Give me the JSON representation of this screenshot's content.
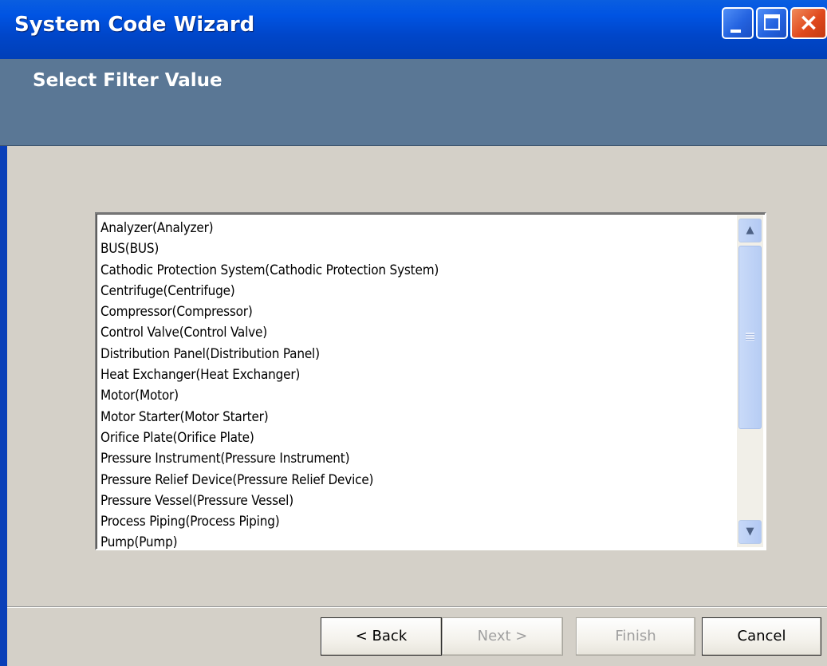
{
  "window": {
    "title": "System Code Wizard",
    "controls": {
      "minimize": "minimize",
      "maximize": "maximize",
      "close": "×"
    }
  },
  "header": {
    "title": "Select Filter Value"
  },
  "list": {
    "items": [
      "Analyzer(Analyzer)",
      "BUS(BUS)",
      "Cathodic Protection System(Cathodic Protection System)",
      "Centrifuge(Centrifuge)",
      "Compressor(Compressor)",
      "Control Valve(Control Valve)",
      "Distribution Panel(Distribution Panel)",
      "Heat Exchanger(Heat Exchanger)",
      "Motor(Motor)",
      "Motor Starter(Motor Starter)",
      "Orifice Plate(Orifice Plate)",
      "Pressure Instrument(Pressure Instrument)",
      "Pressure Relief Device(Pressure Relief Device)",
      "Pressure Vessel(Pressure Vessel)",
      "Process Piping(Process Piping)",
      "Pump(Pump)"
    ],
    "scroll_up_icon": "chevron-up-icon",
    "scroll_down_icon": "chevron-down-icon"
  },
  "buttons": {
    "back": "< Back",
    "next": "Next >",
    "finish": "Finish",
    "cancel": "Cancel"
  },
  "colors": {
    "titlebar": "#0054e3",
    "header_band": "#5a7795",
    "dialog_bg": "#d4d0c8",
    "close_button": "#e0491d"
  }
}
